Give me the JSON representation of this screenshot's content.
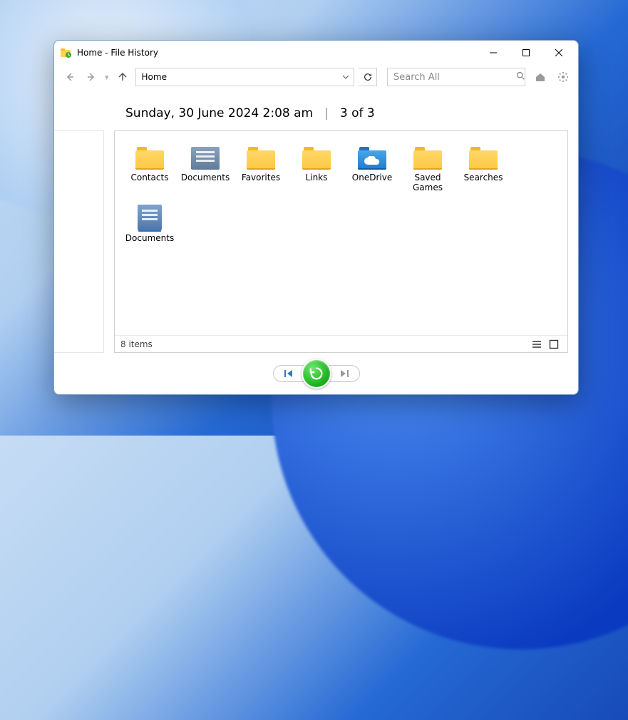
{
  "window": {
    "title": "Home - File History"
  },
  "toolbar": {
    "address": "Home",
    "search_placeholder": "Search All"
  },
  "timestamp": {
    "label": "Sunday, 30 June 2024 2:08 am",
    "position": "3 of 3"
  },
  "items": [
    {
      "label": "Contacts",
      "icon": "folder-yellow"
    },
    {
      "label": "Documents",
      "icon": "doc-folder"
    },
    {
      "label": "Favorites",
      "icon": "folder-yellow"
    },
    {
      "label": "Links",
      "icon": "folder-yellow"
    },
    {
      "label": "OneDrive",
      "icon": "folder-blue-cloud"
    },
    {
      "label": "Saved Games",
      "icon": "folder-yellow"
    },
    {
      "label": "Searches",
      "icon": "folder-yellow"
    },
    {
      "label": "Documents",
      "icon": "lib-icon"
    }
  ],
  "status": {
    "count_label": "8 items"
  }
}
